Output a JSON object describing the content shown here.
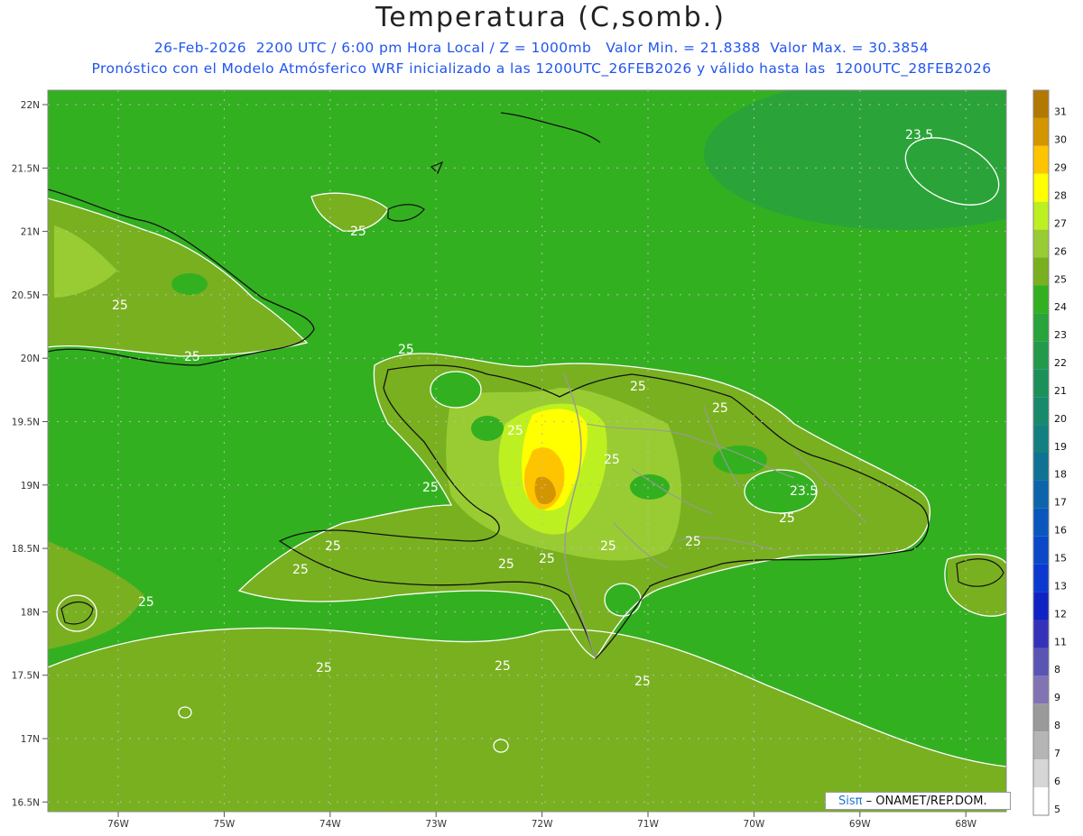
{
  "header": {
    "title": "Temperatura (C,somb.)",
    "line1": "26-Feb-2026  2200 UTC / 6:00 pm Hora Local / Z = 1000mb   Valor Min. = 21.8388  Valor Max. = 30.3854",
    "line2": "Pronóstico con el Modelo Atmósferico WRF inicializado a las 1200UTC_26FEB2026 y válido hasta las  1200UTC_28FEB2026"
  },
  "axes": {
    "lat_ticks": [
      "22N",
      "21.5N",
      "21N",
      "20.5N",
      "20N",
      "19.5N",
      "19N",
      "18.5N",
      "18N",
      "17.5N",
      "17N",
      "16.5N"
    ],
    "lon_ticks": [
      "76W",
      "75W",
      "74W",
      "73W",
      "72W",
      "71W",
      "70W",
      "69W",
      "68W"
    ]
  },
  "colorbar": {
    "labels": [
      "31",
      "30",
      "29",
      "28",
      "27",
      "26",
      "25",
      "24",
      "23",
      "22",
      "21",
      "20",
      "19",
      "18",
      "17",
      "16",
      "15",
      "13",
      "12",
      "11",
      "8",
      "9",
      "8",
      "7",
      "6",
      "5"
    ],
    "colors": [
      "#b37800",
      "#d49600",
      "#ffc400",
      "#ffff00",
      "#bdf020",
      "#99cc33",
      "#79b020",
      "#33b020",
      "#28a43a",
      "#229a4a",
      "#1c9059",
      "#178a6b",
      "#127f80",
      "#0f7294",
      "#0c64aa",
      "#0957bd",
      "#0a48c8",
      "#0b38d0",
      "#0f22c4",
      "#3532ba",
      "#5a54b4",
      "#8274b4",
      "#9a9a9a",
      "#b5b5b5",
      "#d6d6d6",
      "#ffffff"
    ]
  },
  "contour_labels": [
    "25",
    "25",
    "25",
    "25",
    "25",
    "25",
    "25",
    "25",
    "25",
    "25",
    "25",
    "25",
    "25",
    "25",
    "25",
    "25",
    "25",
    "25",
    "25",
    "25",
    "23.5",
    "23.5"
  ],
  "credit": {
    "sis": "Sisπ",
    "rest": "– ONAMET/REP.DOM."
  },
  "colors": {
    "sea_green": "#33b020",
    "olive": "#79b020",
    "light": "#99cc33",
    "warm": "#ffc400",
    "hot": "#d49600"
  }
}
